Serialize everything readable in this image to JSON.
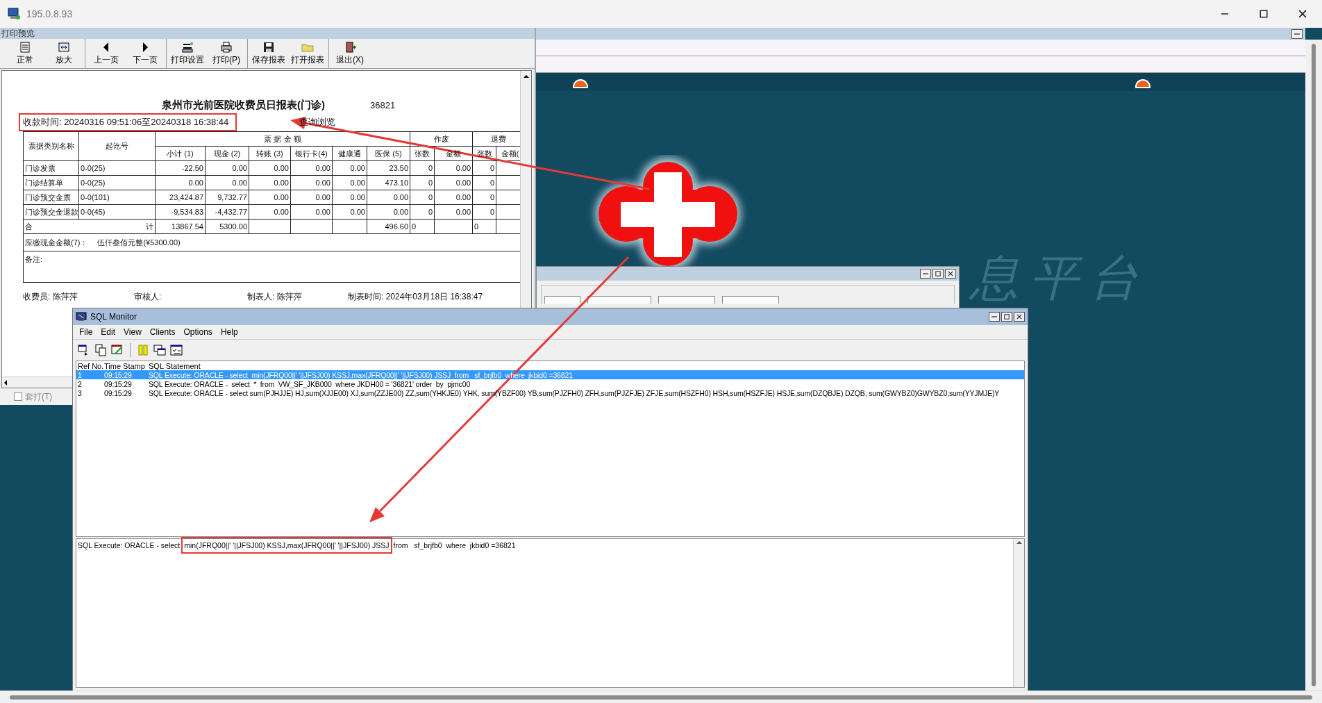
{
  "window": {
    "title": "195.0.8.93"
  },
  "print_preview": {
    "title": "打印预览",
    "toolbar_groups": [
      [
        "正常",
        "放大"
      ],
      [
        "上一页",
        "下一页"
      ],
      [
        "打印设置",
        "打印(P)"
      ],
      [
        "保存报表",
        "打开报表"
      ],
      [
        "退出(X)"
      ]
    ],
    "report": {
      "title": "泉州市光前医院收费员日报表(门诊)",
      "number": "36821",
      "time_range": "收款时间: 20240316 09:51:06至20240318 16:38:44",
      "view_label": "查询浏览",
      "columns": [
        {
          "label": "票据类别名称"
        },
        {
          "label": "起讫号"
        },
        {
          "label": "票 据 金 额",
          "colspan": 6,
          "children": [
            "小计 (1)",
            "现金 (2)",
            "转账 (3)",
            "银行卡(4)",
            "健康通",
            "医保 (5)"
          ]
        },
        {
          "label": "作废",
          "colspan": 2,
          "children": [
            "张数",
            "金额"
          ]
        },
        {
          "label": "退费",
          "colspan": 2,
          "children": [
            "张数",
            "金额("
          ]
        }
      ],
      "rows": [
        [
          "门诊发票",
          "0-0(25)",
          "-22.50",
          "0.00",
          "0.00",
          "0.00",
          "0.00",
          "23.50",
          "0",
          "0.00",
          "0"
        ],
        [
          "门诊结算单",
          "0-0(25)",
          "0.00",
          "0.00",
          "0.00",
          "0.00",
          "0.00",
          "473.10",
          "0",
          "0.00",
          "0"
        ],
        [
          "门诊预交金票",
          "0-0(101)",
          "23,424.87",
          "9,732.77",
          "0.00",
          "0.00",
          "0.00",
          "0.00",
          "0",
          "0.00",
          "0"
        ],
        [
          "门诊预交金退款",
          "0-0(45)",
          "-9,534.83",
          "-4,432.77",
          "0.00",
          "0.00",
          "0.00",
          "0.00",
          "0",
          "0.00",
          "0"
        ]
      ],
      "total": {
        "label_left": "合",
        "label_right": "计",
        "cells": [
          {
            "kind": "value",
            "text": "13867.54"
          },
          {
            "kind": "value",
            "text": "5300.00"
          },
          {
            "kind": "blank"
          },
          {
            "kind": "blank"
          },
          {
            "kind": "blank"
          },
          {
            "kind": "value",
            "text": "496.60"
          },
          {
            "kind": "value",
            "text": "0"
          },
          {
            "kind": "blank"
          },
          {
            "kind": "value",
            "text": "0"
          }
        ]
      },
      "cash_due": {
        "label": "应缴现金金额(7)：",
        "value": "伍仟叁佰元整(¥5300.00)"
      },
      "remarks": "备注:",
      "footer": [
        "收费员: 陈萍萍",
        "审核人:",
        "制表人: 陈萍萍",
        "制表时间: 2024年03月18日 16:38:47"
      ]
    },
    "option": {
      "label": "套打(T)",
      "checked": false
    }
  },
  "wallpaper": {
    "watermark": "息平台"
  },
  "sql_monitor": {
    "title": "SQL Monitor",
    "menu": [
      "File",
      "Edit",
      "View",
      "Clients",
      "Options",
      "Help"
    ],
    "columns": [
      "Ref No.",
      "Time Stamp",
      "SQL Statement"
    ],
    "rows": [
      {
        "ref": "1",
        "time": "09:15:29",
        "statement": "SQL Execute: ORACLE - select  min(JFRQ00||' '||JFSJ00) KSSJ,max(JFRQ00||' '||JFSJ00) JSSJ  from   sf_brjfb0  where  jkbid0 =36821",
        "selected": true
      },
      {
        "ref": "2",
        "time": "09:15:29",
        "statement": "SQL Execute: ORACLE -  select  *  from  VW_SF_JKB000  where JKDH00 = '36821' order  by  pjmc00",
        "selected": false
      },
      {
        "ref": "3",
        "time": "09:15:29",
        "statement": "SQL Execute: ORACLE - select sum(PJHJJE) HJ,sum(XJJE00) XJ,sum(ZZJE00) ZZ,sum(YHKJE0) YHK, sum(YBZF00) YB,sum(PJZFH0) ZFH,sum(PJZFJE) ZFJE,sum(HSZFH0) HSH,sum(HSZFJE) HSJE,sum(DZQBJE) DZQB, sum(GWYBZ0)GWYBZ0,sum(YYJMJE)Y",
        "selected": false
      }
    ],
    "detail": {
      "text_before": "SQL Execute: ORACLE - select",
      "highlighted": "min(JFRQ00||' '||JFSJ00) KSSJ,max(JFRQ00||' '||JFSJ00) JSSJ",
      "text_after": "from   sf_brjfb0  where  jkbid0 =36821"
    }
  }
}
